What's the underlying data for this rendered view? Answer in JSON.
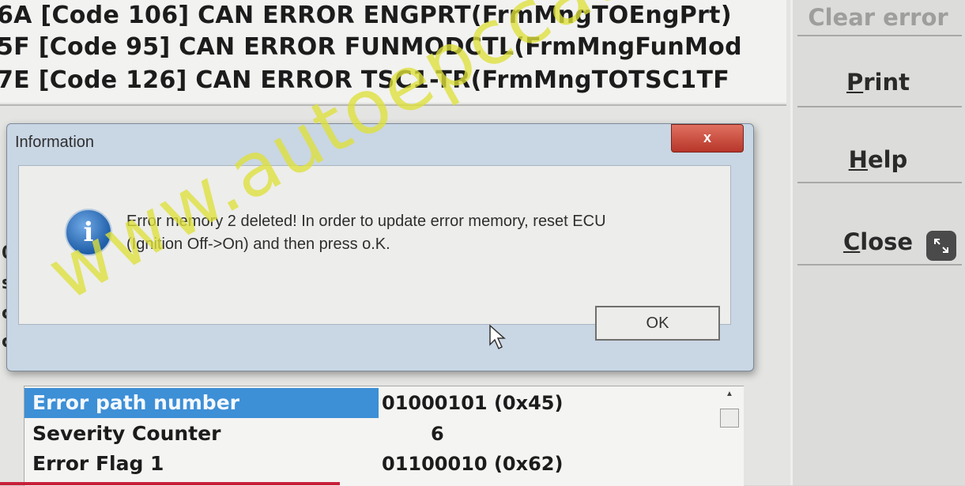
{
  "error_list": {
    "lines": [
      "6A [Code 106] CAN ERROR ENGPRT(FrmMngTOEngPrt)",
      "5F [Code 95] CAN ERROR FUNMODCTL(FrmMngFunMod",
      "7E [Code 126] CAN ERROR TSC1-TR(FrmMngTOTSC1TF"
    ]
  },
  "left_edge_letters": [
    "0",
    "s",
    "c",
    "c"
  ],
  "side_buttons": {
    "clear": {
      "label": "Clear error"
    },
    "print": {
      "mnemonic": "P",
      "rest": "rint"
    },
    "help": {
      "mnemonic": "H",
      "rest": "elp"
    },
    "close": {
      "mnemonic": "C",
      "rest": "lose"
    }
  },
  "dialog": {
    "title": "Information",
    "close_glyph": "x",
    "icon_glyph": "i",
    "message_line1": "Error memory 2 deleted! In order to update error memory, reset ECU",
    "message_line2": "(Ignition Off->On) and then press o.K.",
    "ok_label": "OK"
  },
  "properties": {
    "rows": [
      {
        "name": "Error path number",
        "value": "01000101 (0x45)",
        "selected": true
      },
      {
        "name": "Severity Counter",
        "value": "6",
        "selected": false
      },
      {
        "name": "Error Flag 1",
        "value": "01100010 (0x62)",
        "selected": false
      }
    ]
  },
  "watermark": "www.autoepccatalog.com",
  "colors": {
    "selection": "#3d8fd6",
    "watermark": "#dee03a",
    "dialog_close": "#c74a3b"
  }
}
